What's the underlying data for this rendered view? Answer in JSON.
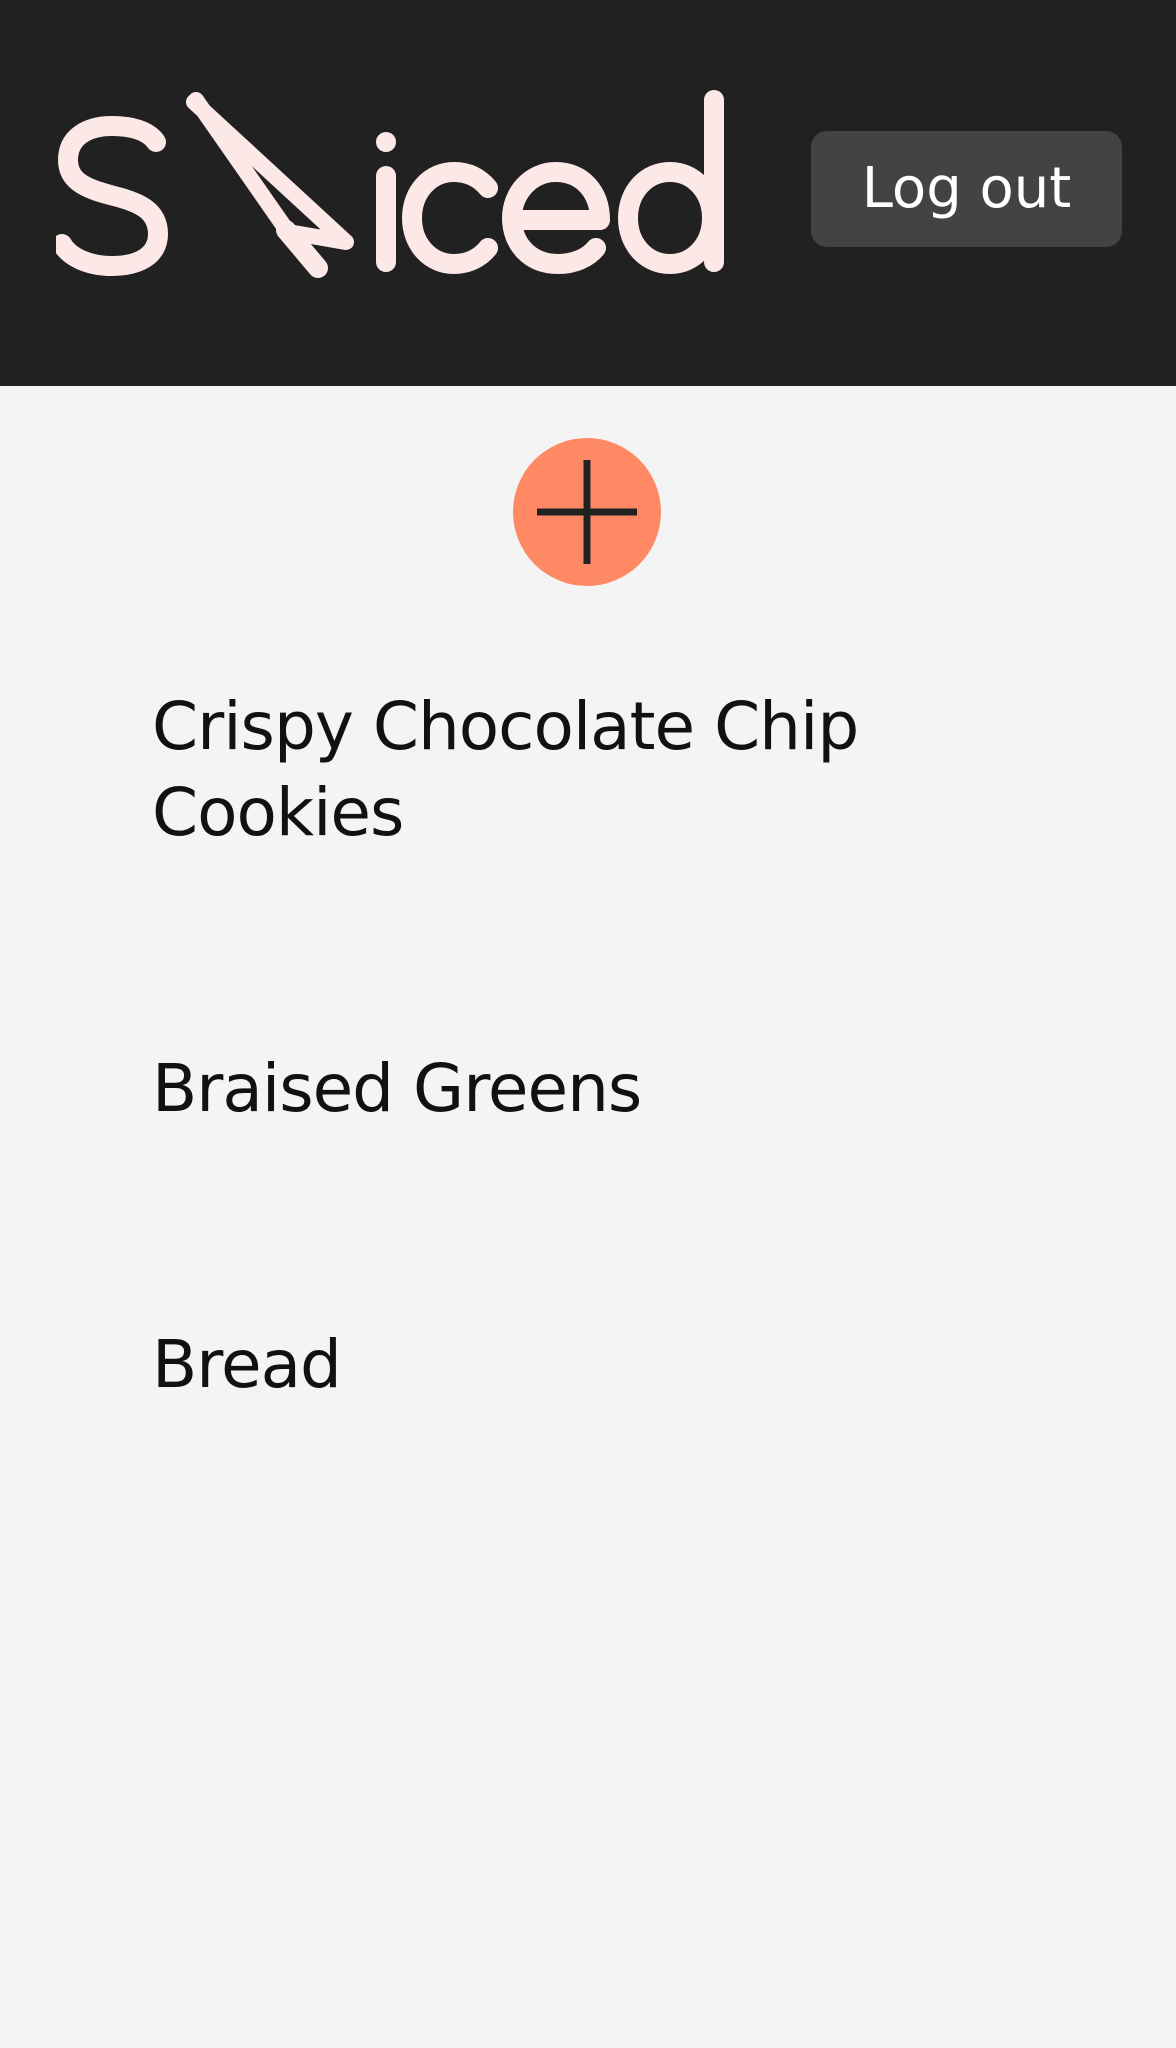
{
  "header": {
    "logo_text": "Sliced",
    "logout_label": "Log out"
  },
  "main": {
    "add_button_icon": "plus-icon",
    "recipes": [
      {
        "title": "Crispy Chocolate Chip Cookies"
      },
      {
        "title": "Braised Greens"
      },
      {
        "title": "Bread"
      }
    ]
  },
  "colors": {
    "header_bg": "#212121",
    "page_bg": "#f4f4f4",
    "logo": "#fce8e6",
    "logout_bg": "#434343",
    "accent": "#ff8965"
  }
}
